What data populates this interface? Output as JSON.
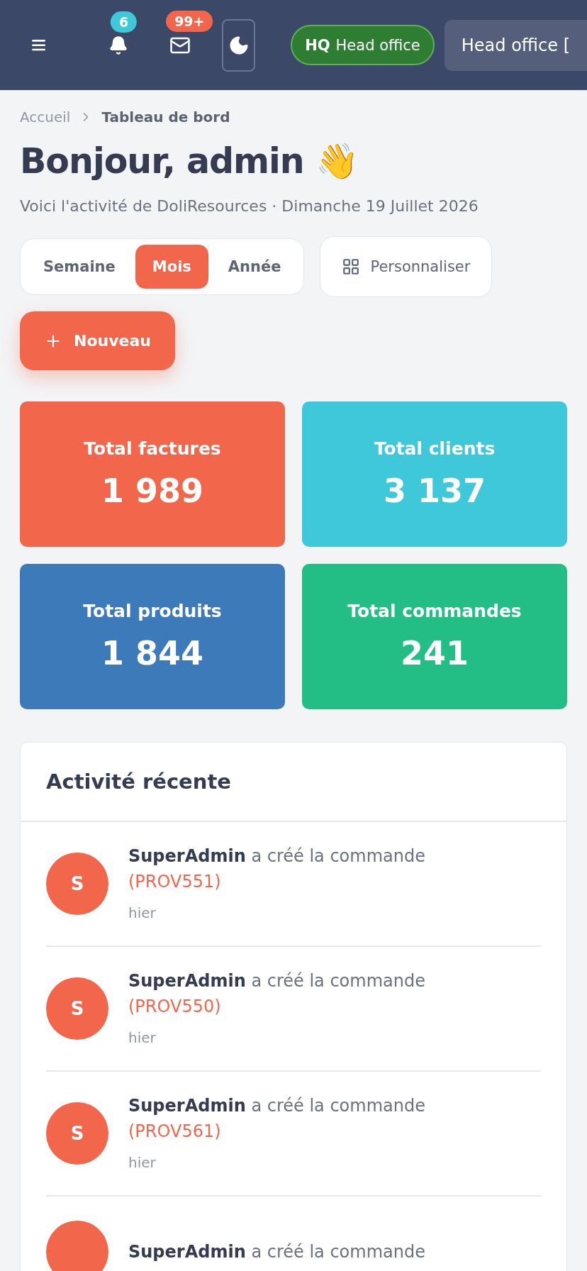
{
  "header": {
    "notifications_badge": "6",
    "messages_badge": "99+",
    "entity_code": "HQ",
    "entity_name": "Head office",
    "entity_select": "Head office ["
  },
  "breadcrumb": [
    "Accueil",
    "Tableau de bord"
  ],
  "greeting": "Bonjour, admin 👋",
  "subtitle": "Voici l'activité de DoliResources · Dimanche 19 Juillet 2026",
  "periods": [
    {
      "label": "Semaine",
      "selected": false
    },
    {
      "label": "Mois",
      "selected": true
    },
    {
      "label": "Année",
      "selected": false
    }
  ],
  "customize_button": "Personnaliser",
  "new_button": "Nouveau",
  "stats": [
    {
      "label": "Total factures",
      "value": "1 989",
      "color": "#f2674b"
    },
    {
      "label": "Total clients",
      "value": "3 137",
      "color": "#3fc8d9"
    },
    {
      "label": "Total produits",
      "value": "1 844",
      "color": "#3d7ab9"
    },
    {
      "label": "Total commandes",
      "value": "241",
      "color": "#22be86"
    }
  ],
  "activity": {
    "title": "Activité récente",
    "items": [
      {
        "avatar": "S",
        "text": "**SuperAdmin** a créé la commande",
        "reference": "(PROV551)",
        "time": "hier"
      },
      {
        "avatar": "S",
        "text": "**SuperAdmin** a créé la commande",
        "reference": "(PROV550)",
        "time": "hier"
      },
      {
        "avatar": "S",
        "text": "**SuperAdmin** a créé la commande",
        "reference": "(PROV561)",
        "time": "hier"
      },
      {
        "text": "**SuperAdmin** a créé la commande"
      }
    ]
  }
}
